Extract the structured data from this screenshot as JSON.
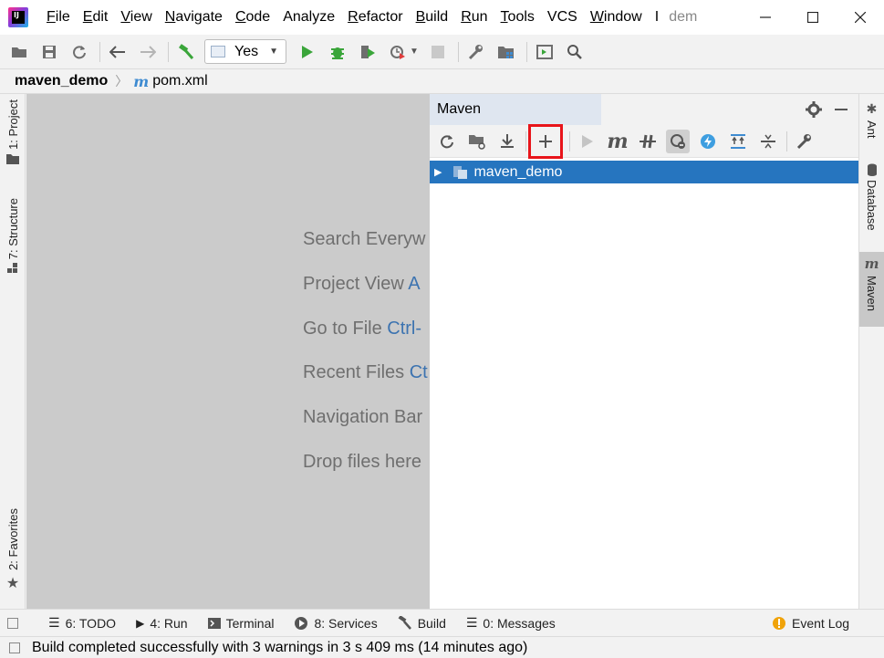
{
  "menu": {
    "items": [
      {
        "label": "File",
        "mnemonic": "F",
        "rest": "ile"
      },
      {
        "label": "Edit",
        "mnemonic": "E",
        "rest": "dit"
      },
      {
        "label": "View",
        "mnemonic": "V",
        "rest": "iew"
      },
      {
        "label": "Navigate",
        "mnemonic": "N",
        "rest": "avigate"
      },
      {
        "label": "Code",
        "mnemonic": "C",
        "rest": "ode"
      },
      {
        "label": "Analyze",
        "mnemonic": "",
        "rest": "Analyze"
      },
      {
        "label": "Refactor",
        "mnemonic": "R",
        "rest": "efactor"
      },
      {
        "label": "Build",
        "mnemonic": "B",
        "rest": "uild"
      },
      {
        "label": "Run",
        "mnemonic": "R",
        "rest": "un"
      },
      {
        "label": "Tools",
        "mnemonic": "T",
        "rest": "ools"
      },
      {
        "label": "VCS",
        "mnemonic": "",
        "rest": "VCS"
      },
      {
        "label": "Window",
        "mnemonic": "W",
        "rest": "indow"
      },
      {
        "label": "Help",
        "mnemonic": "",
        "rest": "I"
      }
    ],
    "title": "dem"
  },
  "toolbar": {
    "run_config": "Yes"
  },
  "breadcrumb": {
    "project": "maven_demo",
    "file": "pom.xml",
    "file_icon": "m"
  },
  "left_tabs": {
    "project": "1: Project",
    "structure": "7: Structure",
    "favorites": "2: Favorites"
  },
  "right_tabs": {
    "ant": "Ant",
    "database": "Database",
    "maven": "Maven",
    "maven_icon": "m"
  },
  "editor": {
    "hints": [
      {
        "text": "Search Everyw",
        "key": ""
      },
      {
        "text": "Project View ",
        "key": "A"
      },
      {
        "text": "Go to File ",
        "key": "Ctrl-"
      },
      {
        "text": "Recent Files ",
        "key": "Ct"
      },
      {
        "text": "Navigation Bar",
        "key": ""
      },
      {
        "text": "Drop files here",
        "key": ""
      }
    ]
  },
  "maven": {
    "title": "Maven",
    "tree_root": "maven_demo",
    "toolbar_m": "m"
  },
  "bottom_bar": {
    "todo": "6: TODO",
    "run": "4: Run",
    "terminal": "Terminal",
    "services": "8: Services",
    "build": "Build",
    "messages": "0: Messages",
    "event_log": "Event Log"
  },
  "status": {
    "message": "Build completed successfully with 3 warnings in 3 s 409 ms (14 minutes ago)"
  },
  "colors": {
    "selection": "#2675bf",
    "highlight_box": "#e8141a",
    "editor_bg": "#cbcbcb",
    "run_green": "#3aa53a"
  }
}
